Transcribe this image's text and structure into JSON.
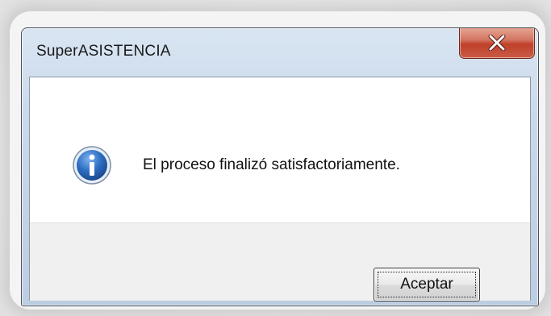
{
  "window": {
    "title": "SuperASISTENCIA",
    "close_glyph": "X"
  },
  "dialog": {
    "icon": "info-icon",
    "message": "El proceso finalizó satisfactoriamente."
  },
  "buttons": {
    "accept_label": "Aceptar"
  },
  "colors": {
    "title_bar": "#c9d8ea",
    "close_button": "#c0412b",
    "info_icon": "#2f6fc4",
    "button_strip": "#f0f0f0"
  }
}
